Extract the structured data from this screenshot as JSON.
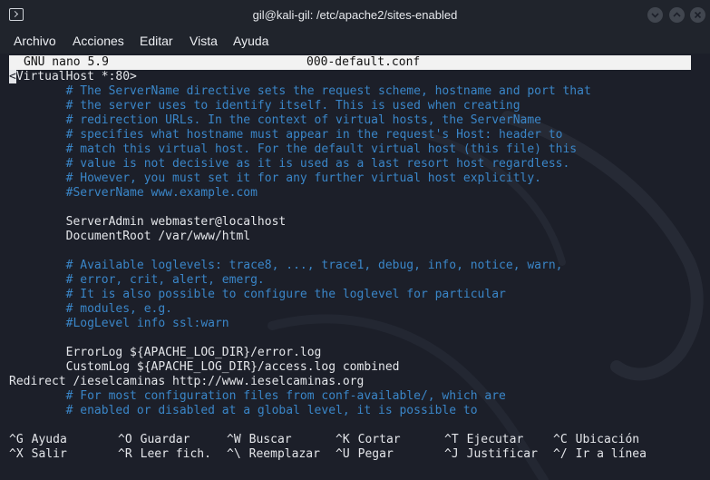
{
  "window": {
    "title": "gil@kali-gil: /etc/apache2/sites-enabled"
  },
  "menu": [
    "Archivo",
    "Acciones",
    "Editar",
    "Vista",
    "Ayuda"
  ],
  "nano": {
    "version": "GNU nano 5.9",
    "filename": "000-default.conf"
  },
  "lines": [
    {
      "text": "<VirtualHost *:80>",
      "kind": "text"
    },
    {
      "text": "        # The ServerName directive sets the request scheme, hostname and port that",
      "kind": "comment"
    },
    {
      "text": "        # the server uses to identify itself. This is used when creating",
      "kind": "comment"
    },
    {
      "text": "        # redirection URLs. In the context of virtual hosts, the ServerName",
      "kind": "comment"
    },
    {
      "text": "        # specifies what hostname must appear in the request's Host: header to",
      "kind": "comment"
    },
    {
      "text": "        # match this virtual host. For the default virtual host (this file) this",
      "kind": "comment"
    },
    {
      "text": "        # value is not decisive as it is used as a last resort host regardless.",
      "kind": "comment"
    },
    {
      "text": "        # However, you must set it for any further virtual host explicitly.",
      "kind": "comment"
    },
    {
      "text": "        #ServerName www.example.com",
      "kind": "comment"
    },
    {
      "text": "",
      "kind": "text"
    },
    {
      "text": "        ServerAdmin webmaster@localhost",
      "kind": "text"
    },
    {
      "text": "        DocumentRoot /var/www/html",
      "kind": "text"
    },
    {
      "text": "",
      "kind": "text"
    },
    {
      "text": "        # Available loglevels: trace8, ..., trace1, debug, info, notice, warn,",
      "kind": "comment"
    },
    {
      "text": "        # error, crit, alert, emerg.",
      "kind": "comment"
    },
    {
      "text": "        # It is also possible to configure the loglevel for particular",
      "kind": "comment"
    },
    {
      "text": "        # modules, e.g.",
      "kind": "comment"
    },
    {
      "text": "        #LogLevel info ssl:warn",
      "kind": "comment"
    },
    {
      "text": "",
      "kind": "text"
    },
    {
      "text": "        ErrorLog ${APACHE_LOG_DIR}/error.log",
      "kind": "text"
    },
    {
      "text": "        CustomLog ${APACHE_LOG_DIR}/access.log combined",
      "kind": "text"
    },
    {
      "text": "Redirect /ieselcaminas http://www.ieselcaminas.org",
      "kind": "text"
    },
    {
      "text": "        # For most configuration files from conf-available/, which are",
      "kind": "comment"
    },
    {
      "text": "        # enabled or disabled at a global level, it is possible to",
      "kind": "comment"
    }
  ],
  "shortcuts": [
    [
      {
        "key": "^G",
        "label": "Ayuda"
      },
      {
        "key": "^O",
        "label": "Guardar"
      },
      {
        "key": "^W",
        "label": "Buscar"
      },
      {
        "key": "^K",
        "label": "Cortar"
      },
      {
        "key": "^T",
        "label": "Ejecutar"
      },
      {
        "key": "^C",
        "label": "Ubicación"
      }
    ],
    [
      {
        "key": "^X",
        "label": "Salir"
      },
      {
        "key": "^R",
        "label": "Leer fich."
      },
      {
        "key": "^\\",
        "label": "Reemplazar"
      },
      {
        "key": "^U",
        "label": "Pegar"
      },
      {
        "key": "^J",
        "label": "Justificar"
      },
      {
        "key": "^/",
        "label": "Ir a línea"
      }
    ]
  ],
  "colors": {
    "background": "#1c1f29",
    "comment": "#3a86c8",
    "text": "#e4e6ea",
    "header_bg": "#f2f2f2"
  }
}
